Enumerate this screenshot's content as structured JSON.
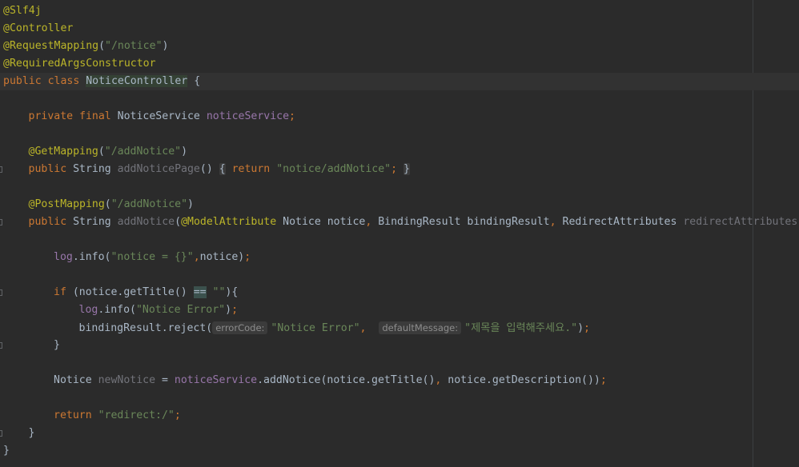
{
  "editor": {
    "lines": [
      {
        "indent": 0,
        "tokens": [
          {
            "t": "@Slf4j",
            "c": "annotation"
          }
        ]
      },
      {
        "indent": 0,
        "tokens": [
          {
            "t": "@Controller",
            "c": "annotation"
          }
        ]
      },
      {
        "indent": 0,
        "tokens": [
          {
            "t": "@RequestMapping",
            "c": "annotation"
          },
          {
            "t": "(",
            "c": "plain"
          },
          {
            "t": "\"/notice\"",
            "c": "string"
          },
          {
            "t": ")",
            "c": "plain"
          }
        ]
      },
      {
        "indent": 0,
        "tokens": [
          {
            "t": "@RequiredArgsConstructor",
            "c": "annotation"
          }
        ]
      },
      {
        "indent": 0,
        "current": true,
        "tokens": [
          {
            "t": "public class ",
            "c": "keyword"
          },
          {
            "t": "NoticeController",
            "c": "plain class-highlight"
          },
          {
            "t": " {",
            "c": "plain"
          }
        ]
      },
      {
        "indent": 0,
        "tokens": []
      },
      {
        "indent": 1,
        "tokens": [
          {
            "t": "private final ",
            "c": "keyword"
          },
          {
            "t": "NoticeService ",
            "c": "plain"
          },
          {
            "t": "noticeService",
            "c": "field"
          },
          {
            "t": ";",
            "c": "keyword"
          }
        ]
      },
      {
        "indent": 0,
        "tokens": []
      },
      {
        "indent": 1,
        "tokens": [
          {
            "t": "@GetMapping",
            "c": "annotation"
          },
          {
            "t": "(",
            "c": "plain"
          },
          {
            "t": "\"/addNotice\"",
            "c": "string"
          },
          {
            "t": ")",
            "c": "plain"
          }
        ]
      },
      {
        "indent": 1,
        "fold": true,
        "tokens": [
          {
            "t": "public ",
            "c": "keyword"
          },
          {
            "t": "String ",
            "c": "plain"
          },
          {
            "t": "addNoticePage",
            "c": "unused"
          },
          {
            "t": "() ",
            "c": "plain"
          },
          {
            "t": "{",
            "c": "fold"
          },
          {
            "t": " ",
            "c": "plain"
          },
          {
            "t": "return ",
            "c": "keyword"
          },
          {
            "t": "\"notice/addNotice\"",
            "c": "string"
          },
          {
            "t": "; ",
            "c": "keyword"
          },
          {
            "t": "}",
            "c": "fold"
          }
        ]
      },
      {
        "indent": 0,
        "tokens": []
      },
      {
        "indent": 1,
        "tokens": [
          {
            "t": "@PostMapping",
            "c": "annotation"
          },
          {
            "t": "(",
            "c": "plain"
          },
          {
            "t": "\"/addNotice\"",
            "c": "string"
          },
          {
            "t": ")",
            "c": "plain"
          }
        ]
      },
      {
        "indent": 1,
        "fold": true,
        "tokens": [
          {
            "t": "public ",
            "c": "keyword"
          },
          {
            "t": "String ",
            "c": "plain"
          },
          {
            "t": "addNotice",
            "c": "unused"
          },
          {
            "t": "(",
            "c": "plain"
          },
          {
            "t": "@ModelAttribute ",
            "c": "annotation"
          },
          {
            "t": "Notice notice",
            "c": "plain"
          },
          {
            "t": ", ",
            "c": "keyword"
          },
          {
            "t": "BindingResult bindingResult",
            "c": "plain"
          },
          {
            "t": ", ",
            "c": "keyword"
          },
          {
            "t": "RedirectAttributes ",
            "c": "plain"
          },
          {
            "t": "redirectAttributes",
            "c": "unused"
          },
          {
            "t": "){",
            "c": "plain"
          }
        ]
      },
      {
        "indent": 0,
        "tokens": []
      },
      {
        "indent": 2,
        "tokens": [
          {
            "t": "log",
            "c": "field"
          },
          {
            "t": ".info(",
            "c": "plain"
          },
          {
            "t": "\"notice = {}\"",
            "c": "string"
          },
          {
            "t": ",",
            "c": "keyword"
          },
          {
            "t": "notice)",
            "c": "plain"
          },
          {
            "t": ";",
            "c": "keyword"
          }
        ]
      },
      {
        "indent": 0,
        "tokens": []
      },
      {
        "indent": 2,
        "fold": true,
        "tokens": [
          {
            "t": "if ",
            "c": "keyword"
          },
          {
            "t": "(notice.getTitle() ",
            "c": "plain"
          },
          {
            "t": "==",
            "c": "plain op-highlight"
          },
          {
            "t": " ",
            "c": "plain"
          },
          {
            "t": "\"\"",
            "c": "string"
          },
          {
            "t": "){",
            "c": "plain"
          }
        ]
      },
      {
        "indent": 3,
        "tokens": [
          {
            "t": "log",
            "c": "field"
          },
          {
            "t": ".info(",
            "c": "plain"
          },
          {
            "t": "\"Notice Error\"",
            "c": "string"
          },
          {
            "t": ")",
            "c": "plain"
          },
          {
            "t": ";",
            "c": "keyword"
          }
        ]
      },
      {
        "indent": 3,
        "tokens": [
          {
            "t": "bindingResult.reject(",
            "c": "plain"
          },
          {
            "t": "errorCode:",
            "c": "hint"
          },
          {
            "t": "\"Notice Error\"",
            "c": "string"
          },
          {
            "t": ",  ",
            "c": "keyword"
          },
          {
            "t": "defaultMessage:",
            "c": "hint"
          },
          {
            "t": "\"제목을 입력해주세요.\"",
            "c": "string"
          },
          {
            "t": ")",
            "c": "plain"
          },
          {
            "t": ";",
            "c": "keyword"
          }
        ]
      },
      {
        "indent": 2,
        "fold": true,
        "tokens": [
          {
            "t": "}",
            "c": "plain"
          }
        ]
      },
      {
        "indent": 0,
        "tokens": []
      },
      {
        "indent": 2,
        "tokens": [
          {
            "t": "Notice ",
            "c": "plain"
          },
          {
            "t": "newNotice",
            "c": "unused"
          },
          {
            "t": " = ",
            "c": "plain"
          },
          {
            "t": "noticeService",
            "c": "field"
          },
          {
            "t": ".addNotice(notice.getTitle()",
            "c": "plain"
          },
          {
            "t": ", ",
            "c": "keyword"
          },
          {
            "t": "notice.getDescription())",
            "c": "plain"
          },
          {
            "t": ";",
            "c": "keyword"
          }
        ]
      },
      {
        "indent": 0,
        "tokens": []
      },
      {
        "indent": 2,
        "tokens": [
          {
            "t": "return ",
            "c": "keyword"
          },
          {
            "t": "\"redirect:/\"",
            "c": "string"
          },
          {
            "t": ";",
            "c": "keyword"
          }
        ]
      },
      {
        "indent": 1,
        "fold": true,
        "tokens": [
          {
            "t": "}",
            "c": "plain"
          }
        ]
      },
      {
        "indent": 0,
        "tokens": [
          {
            "t": "}",
            "c": "plain"
          }
        ]
      }
    ]
  }
}
